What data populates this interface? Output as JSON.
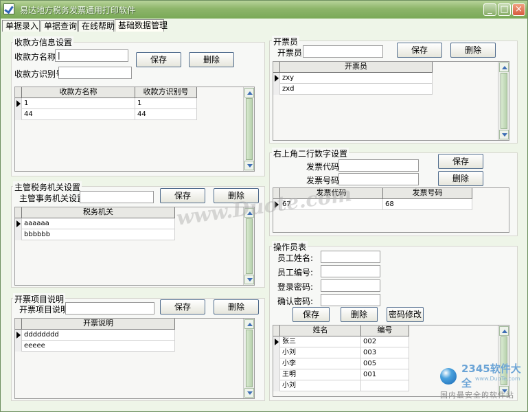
{
  "window": {
    "title": "易达地方税务发票通用打印软件",
    "minimize": "_",
    "maximize": "□",
    "close": "×"
  },
  "tabs": [
    "单据录入",
    "单据查询",
    "在线帮助",
    "基础数据管理"
  ],
  "payee": {
    "group": "收款方信息设置",
    "name_label": "收款方名称",
    "id_label": "收款方识别号",
    "save": "保存",
    "delete": "删除",
    "headers": [
      "收款方名称",
      "收款方识别号"
    ],
    "rows": [
      [
        "1",
        "1"
      ],
      [
        "44",
        "44"
      ]
    ]
  },
  "tax": {
    "group": "主管税务机关设置",
    "label": "主管事务机关设置",
    "save": "保存",
    "delete": "删除",
    "header": "税务机关",
    "rows": [
      "aaaaaa",
      "bbbbbb"
    ]
  },
  "item": {
    "group": "开票项目说明",
    "label": "开票项目说明",
    "save": "保存",
    "delete": "删除",
    "header": "开票说明",
    "rows": [
      "dddddddd",
      "eeeee"
    ]
  },
  "issuer": {
    "group": "开票员",
    "label": "开票员",
    "save": "保存",
    "delete": "删除",
    "header": "开票员",
    "rows": [
      "zxy",
      "zxd"
    ]
  },
  "number": {
    "group": "右上角二行数字设置",
    "code_label": "发票代码",
    "number_label": "发票号码",
    "save": "保存",
    "delete": "删除",
    "headers": [
      "发票代码",
      "发票号码"
    ],
    "rows": [
      [
        "67",
        "68"
      ]
    ]
  },
  "operator": {
    "group": "操作员表",
    "name": "员工姓名:",
    "id": "员工编号:",
    "login": "登录密码:",
    "confirm": "确认密码:",
    "save": "保存",
    "delete": "删除",
    "change": "密码修改",
    "headers": [
      "姓名",
      "编号"
    ],
    "rows": [
      [
        "张三",
        "002"
      ],
      [
        "小刘",
        "003"
      ],
      [
        "小李",
        "005"
      ],
      [
        "王明",
        "001"
      ],
      [
        "小刘",
        ""
      ]
    ]
  },
  "watermark": "www.Duote.com",
  "logo": {
    "text": "2345软件大全",
    "sub": "www.DuoTe.com",
    "slogan": "国内最安全的软件站"
  }
}
